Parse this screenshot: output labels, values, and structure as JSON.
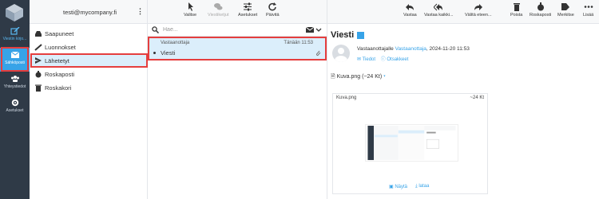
{
  "nav": {
    "items": [
      {
        "label": "Viestin kirjo...",
        "icon": "compose-icon"
      },
      {
        "label": "Sähköposti",
        "icon": "envelope-icon"
      },
      {
        "label": "Yhteystiedot",
        "icon": "contacts-icon"
      },
      {
        "label": "Asetukset",
        "icon": "gear-icon"
      }
    ]
  },
  "account": {
    "email": "testi@mycompany.fi"
  },
  "folders": [
    {
      "label": "Saapuneet",
      "icon": "inbox-icon"
    },
    {
      "label": "Luonnokset",
      "icon": "pencil-icon"
    },
    {
      "label": "Lähetetyt",
      "icon": "sent-icon"
    },
    {
      "label": "Roskaposti",
      "icon": "spam-icon"
    },
    {
      "label": "Roskakori",
      "icon": "trash-icon"
    }
  ],
  "list_toolbar": {
    "select": "Valitse",
    "threads": "Viestiketjut",
    "settings": "Asetukset",
    "refresh": "Päivitä"
  },
  "search": {
    "placeholder": "Hae..."
  },
  "message": {
    "from": "Vastaanottaja",
    "date": "Tänään 11:53",
    "subject": "Viesti"
  },
  "reader_toolbar": {
    "reply": "Vastaa",
    "reply_all": "Vastaa kaikki...",
    "forward": "Välitä eteen...",
    "delete": "Poista",
    "spam": "Roskaposti",
    "mark": "Merkitse",
    "more": "Lisää"
  },
  "reader": {
    "title": "Viesti",
    "recipient_prefix": "Vastaanottajalle",
    "recipient": "Vastaanottaja",
    "sent_date": ", 2024-11-20 11:53",
    "details": "Tiedot",
    "headers": "Otsakkeet",
    "attachment_label": "Kuva.png (~24 Kt)",
    "attachment_name": "Kuva.png",
    "attachment_size": "~24 Kt",
    "show": "Näytä",
    "download": "lataa"
  },
  "colors": {
    "accent": "#37a3e8",
    "nav_bg": "#2f3a47",
    "highlight": "#e53e3e",
    "selected": "#dbeefb"
  }
}
